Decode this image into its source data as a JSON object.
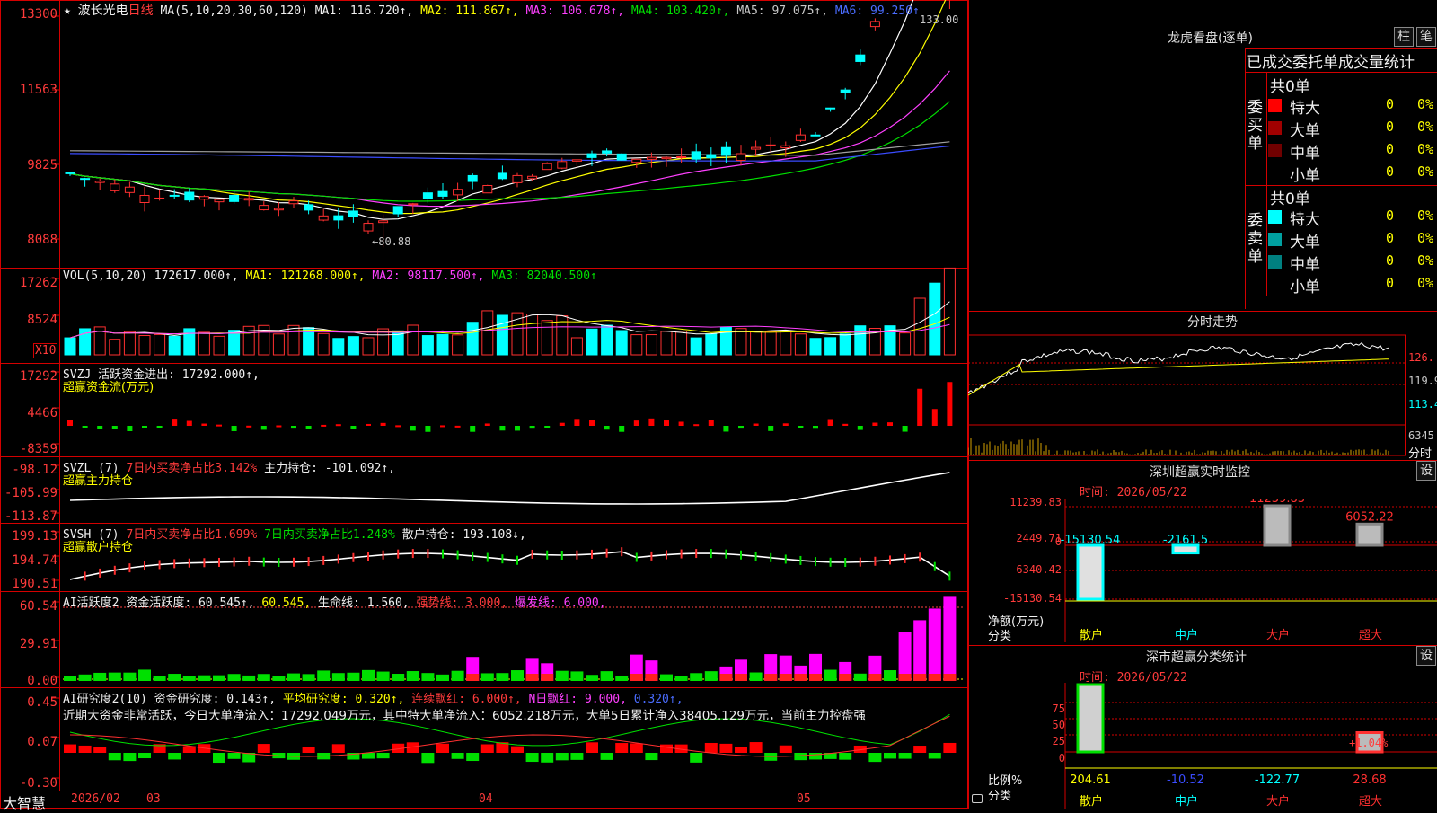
{
  "stock": {
    "name": "波长光电",
    "period": "日线",
    "star": "★"
  },
  "ma_line": {
    "label": "MA(5,10,20,30,60,120)",
    "ma1": "MA1: 116.720↑,",
    "ma2": "MA2: 111.867↑,",
    "ma3": "MA3: 106.678↑,",
    "ma4": "MA4: 103.420↑,",
    "ma5": "MA5: 97.075↑,",
    "ma6": "MA6: 99.250↑"
  },
  "price_axis": [
    "13300",
    "11563",
    "9825",
    "8088"
  ],
  "price_annotations": {
    "high": "133.00",
    "low": "80.88"
  },
  "vol_line": {
    "label": "VOL(5,10,20)",
    "value": "172617.000↑,",
    "ma1": "MA1: 121268.000↑,",
    "ma2": "MA2: 98117.500↑,",
    "ma3": "MA3: 82040.500↑"
  },
  "vol_axis": [
    "17262",
    "8524"
  ],
  "vol_unit": "X10",
  "svzj": {
    "label": "SVZJ",
    "line": "活跃资金进出: 17292.000↑,",
    "sub": "超赢资金流(万元)",
    "axis": [
      "17292",
      "4466",
      "-8359"
    ]
  },
  "svzl": {
    "label": "SVZL (7)",
    "line1": "7日内买卖净占比3.142%",
    "line2": "主力持仓: -101.092↑,",
    "sub": "超赢主力持仓",
    "axis": [
      "-98.12",
      "-105.99",
      "-113.87"
    ]
  },
  "svsh": {
    "label": "SVSH (7)",
    "line1": "7日内买卖净占比1.699%",
    "line2": "7日内买卖净占比1.248%",
    "line3": "散户持仓: 193.108↓,",
    "sub": "超赢散户持仓",
    "axis": [
      "199.13",
      "194.74",
      "190.51"
    ]
  },
  "ai_act": {
    "label": "AI活跃度2",
    "p1": "资金活跃度: 60.545↑,",
    "p2": "60.545,",
    "p3": "生命线: 1.560,",
    "p4": "强势线: 3.000,",
    "p5": "爆发线: 6.000,",
    "axis": [
      "60.54",
      "29.91",
      "0.00"
    ]
  },
  "ai_res": {
    "label": "AI研究度2(10)",
    "p1": "资金研究度: 0.143↑,",
    "p2": "平均研究度: 0.320↑,",
    "p3": "连续飘红: 6.000↑,",
    "p4": "N日飘红: 9.000,",
    "p5": "0.320↑,",
    "axis": [
      "0.45",
      "0.07",
      "-0.30"
    ],
    "comment": "近期大资金非常活跃，今日大单净流入：17292.049万元，其中特大单净流入：6052.218万元，大单5日累计净入38405.129万元，当前主力控盘强"
  },
  "bottom_axis": {
    "brand": "大智慧",
    "labels": [
      "2026/02",
      "03",
      "04",
      "05"
    ]
  },
  "right": {
    "lhb_title": "龙虎看盘(逐单)",
    "btn_bar": "柱",
    "btn_tick": "笔",
    "stat_title": "已成交委托单成交量统计",
    "buy": {
      "side": "委买单",
      "total": "共0单",
      "rows": [
        {
          "label": "特大",
          "count": "0",
          "pct": "0%",
          "color": "#ff0000"
        },
        {
          "label": "大单",
          "count": "0",
          "pct": "0%",
          "color": "#a00000"
        },
        {
          "label": "中单",
          "count": "0",
          "pct": "0%",
          "color": "#700000"
        },
        {
          "label": "小单",
          "count": "0",
          "pct": "0%",
          "color": ""
        }
      ]
    },
    "sell": {
      "side": "委卖单",
      "total": "共0单",
      "rows": [
        {
          "label": "特大",
          "count": "0",
          "pct": "0%",
          "color": "#00ffff"
        },
        {
          "label": "大单",
          "count": "0",
          "pct": "0%",
          "color": "#00a0a0"
        },
        {
          "label": "中单",
          "count": "0",
          "pct": "0%",
          "color": "#008080"
        },
        {
          "label": "小单",
          "count": "0",
          "pct": "0%",
          "color": ""
        }
      ]
    },
    "intraday_title": "分时走势",
    "intraday_axis": [
      "126.",
      "119.9",
      "113.4",
      "6345",
      "分时"
    ],
    "monitor": {
      "title": "深圳超赢实时监控",
      "btn": "设",
      "time": "时间: 2026/05/22",
      "axis": [
        "11239.83",
        "2449.71",
        "0",
        "-6340.42",
        "-15130.54"
      ],
      "cats": [
        "散户",
        "中户",
        "大户",
        "超大"
      ],
      "values": [
        -15130.54,
        -2161.5,
        11239.83,
        6052.22
      ],
      "value_labels": [
        "-15130.54",
        "-2161.5",
        "11239.83",
        "6052.22"
      ],
      "ylabel1": "净额(万元)",
      "ylabel2": "分类"
    },
    "classify": {
      "title": "深市超赢分类统计",
      "btn": "设",
      "time": "时间: 2026/05/22",
      "axis": [
        "75",
        "50",
        "25",
        "0"
      ],
      "cats": [
        "散户",
        "中户",
        "大户",
        "超大"
      ],
      "values": [
        204.61,
        -10.52,
        -122.77,
        28.68
      ],
      "value_labels": [
        "204.61",
        "-10.52",
        "-122.77",
        "28.68"
      ],
      "note": "+1.04%",
      "ylabel1": "比例%",
      "ylabel2": "分类"
    }
  },
  "chart_data": [
    {
      "type": "candlestick",
      "title": "波长光电 日线",
      "ylim": [
        80.88,
        133.0
      ],
      "annotations": [
        "133.00",
        "80.88"
      ]
    },
    {
      "type": "bar",
      "title": "深圳超赢实时监控",
      "categories": [
        "散户",
        "中户",
        "大户",
        "超大"
      ],
      "values": [
        -15130.54,
        -2161.5,
        11239.83,
        6052.22
      ],
      "ylabel": "净额(万元)",
      "xlabel": "分类"
    },
    {
      "type": "bar",
      "title": "深市超赢分类统计",
      "categories": [
        "散户",
        "中户",
        "大户",
        "超大"
      ],
      "values": [
        204.61,
        -10.52,
        -122.77,
        28.68
      ],
      "ylabel": "比例%",
      "xlabel": "分类"
    }
  ]
}
